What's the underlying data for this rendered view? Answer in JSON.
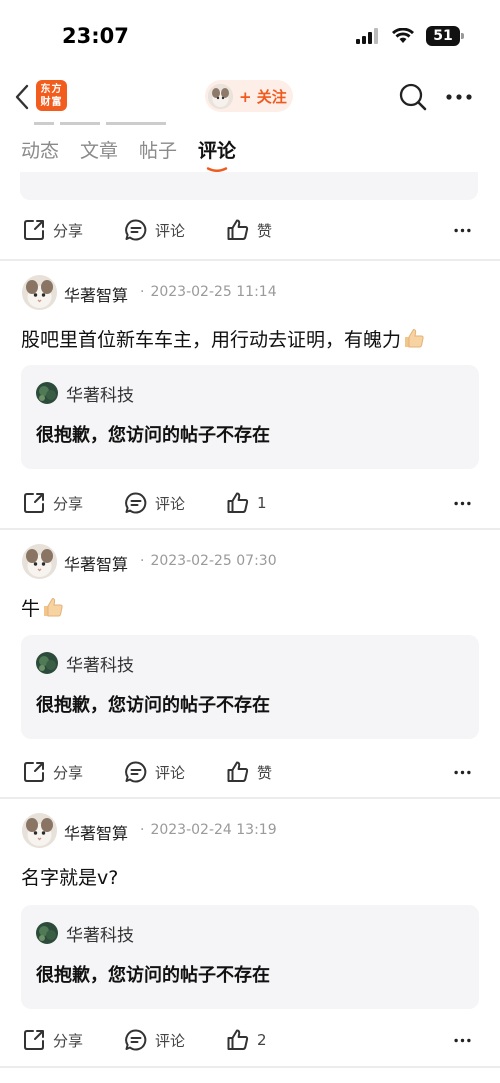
{
  "status_bar": {
    "time": "23:07",
    "battery": "51"
  },
  "header": {
    "logo_line1": "东方",
    "logo_line2": "财富",
    "follow_label": "+ 关注"
  },
  "tabs": [
    {
      "label": "动态"
    },
    {
      "label": "文章"
    },
    {
      "label": "帖子"
    },
    {
      "label": "评论",
      "active": true
    }
  ],
  "actions": {
    "share": "分享",
    "comment": "评论"
  },
  "posts": [
    {
      "author": "华著智算",
      "datetime": "2023-02-25 11:14",
      "text": "股吧里首位新车车主，用行动去证明，有魄力",
      "has_thumb_emoji": true,
      "quote": {
        "author": "华著科技",
        "text": "很抱歉，您访问的帖子不存在"
      },
      "like_label": "1"
    },
    {
      "author": "华著智算",
      "datetime": "2023-02-25 07:30",
      "text": "牛",
      "has_thumb_emoji": true,
      "quote": {
        "author": "华著科技",
        "text": "很抱歉，您访问的帖子不存在"
      },
      "like_label": "赞"
    },
    {
      "author": "华著智算",
      "datetime": "2023-02-24 13:19",
      "text": "名字就是v?",
      "has_thumb_emoji": false,
      "quote": {
        "author": "华著科技",
        "text": "很抱歉，您访问的帖子不存在"
      },
      "like_label": "2"
    }
  ],
  "first_row_like_label": "赞",
  "colors": {
    "accent": "#f05a1e",
    "logo": "#f25c1c",
    "quote_bg": "#f5f5f7"
  }
}
